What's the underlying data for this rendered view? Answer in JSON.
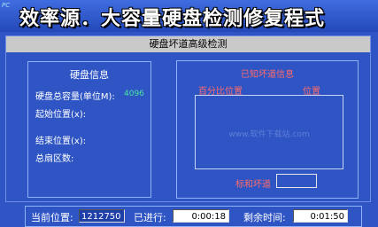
{
  "app": {
    "logo_text": "PC",
    "title": "效率源．大容量硬盘检测修复程式"
  },
  "window": {
    "header_title": "硬盘坏道高级检测"
  },
  "disk_info": {
    "title": "硬盘信息",
    "capacity_label": "硬盘总容量(单位M):",
    "capacity_value": "4096",
    "start_label": "起始位置(x):",
    "end_label": "结束位置(x):",
    "sectors_label": "总扇区数:"
  },
  "bad_sectors": {
    "title": "已知坏道信息",
    "col_percent": "百分比位置",
    "col_position": "位置",
    "watermark": "www.软件下载站.com",
    "mark_label": "标和坏道",
    "mark_value": ""
  },
  "status": {
    "current_label": "当前位置:",
    "current_value": "1212750",
    "elapsed_label": "已进行:",
    "elapsed_value": "0:00:18",
    "remaining_label": "剩余时间:",
    "remaining_value": "0:01:50"
  }
}
